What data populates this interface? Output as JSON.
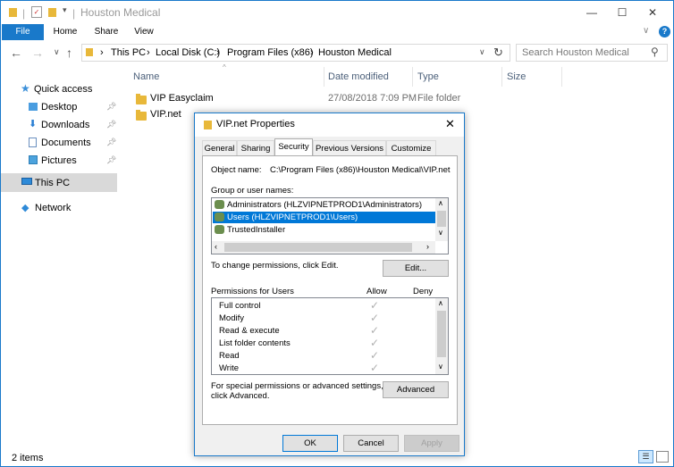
{
  "window": {
    "title": "Houston Medical",
    "minimize_glyph": "—",
    "maximize_glyph": "☐",
    "close_glyph": "✕"
  },
  "ribbon": {
    "tabs": [
      "File",
      "Home",
      "Share",
      "View"
    ],
    "help": "?"
  },
  "address": {
    "crumbs": [
      "This PC",
      "Local Disk (C:)",
      "Program Files (x86)",
      "Houston Medical"
    ],
    "search_placeholder": "Search Houston Medical"
  },
  "sidebar": {
    "items": [
      {
        "label": "Quick access",
        "icon": "star-icon"
      },
      {
        "label": "Desktop",
        "icon": "desktop-folder-icon",
        "pinned": true
      },
      {
        "label": "Downloads",
        "icon": "downloads-icon",
        "pinned": true
      },
      {
        "label": "Documents",
        "icon": "documents-icon",
        "pinned": true
      },
      {
        "label": "Pictures",
        "icon": "pictures-icon",
        "pinned": true
      },
      {
        "label": "This PC",
        "icon": "computer-icon",
        "selected": true
      },
      {
        "label": "Network",
        "icon": "network-icon"
      }
    ]
  },
  "filelist": {
    "columns": [
      "Name",
      "Date modified",
      "Type",
      "Size"
    ],
    "rows": [
      {
        "name": "VIP Easyclaim",
        "date": "27/08/2018 7:09 PM",
        "type": "File folder"
      },
      {
        "name": "VIP.net",
        "date": "",
        "type": ""
      }
    ]
  },
  "status": {
    "text": "2 items"
  },
  "dialog": {
    "title": "VIP.net Properties",
    "tabs": [
      "General",
      "Sharing",
      "Security",
      "Previous Versions",
      "Customize"
    ],
    "active_tab": "Security",
    "object_name_label": "Object name:",
    "object_name_value": "C:\\Program Files (x86)\\Houston Medical\\VIP.net",
    "group_label": "Group or user names:",
    "groups": [
      {
        "name": "Administrators (HLZVIPNETPROD1\\Administrators)",
        "selected": false
      },
      {
        "name": "Users (HLZVIPNETPROD1\\Users)",
        "selected": true
      },
      {
        "name": "TrustedInstaller",
        "selected": false
      }
    ],
    "change_text": "To change permissions, click Edit.",
    "edit_button": "Edit...",
    "perm_header": "Permissions for Users",
    "allow_header": "Allow",
    "deny_header": "Deny",
    "permissions": [
      {
        "name": "Full control"
      },
      {
        "name": "Modify"
      },
      {
        "name": "Read & execute"
      },
      {
        "name": "List folder contents"
      },
      {
        "name": "Read"
      },
      {
        "name": "Write"
      }
    ],
    "special_text_1": "For special permissions or advanced settings,",
    "special_text_2": "click Advanced.",
    "advanced_button": "Advanced",
    "ok_button": "OK",
    "cancel_button": "Cancel",
    "apply_button": "Apply"
  },
  "colors": {
    "accent": "#1979ca",
    "selection": "#0078d7",
    "folder": "#e8b83a"
  }
}
